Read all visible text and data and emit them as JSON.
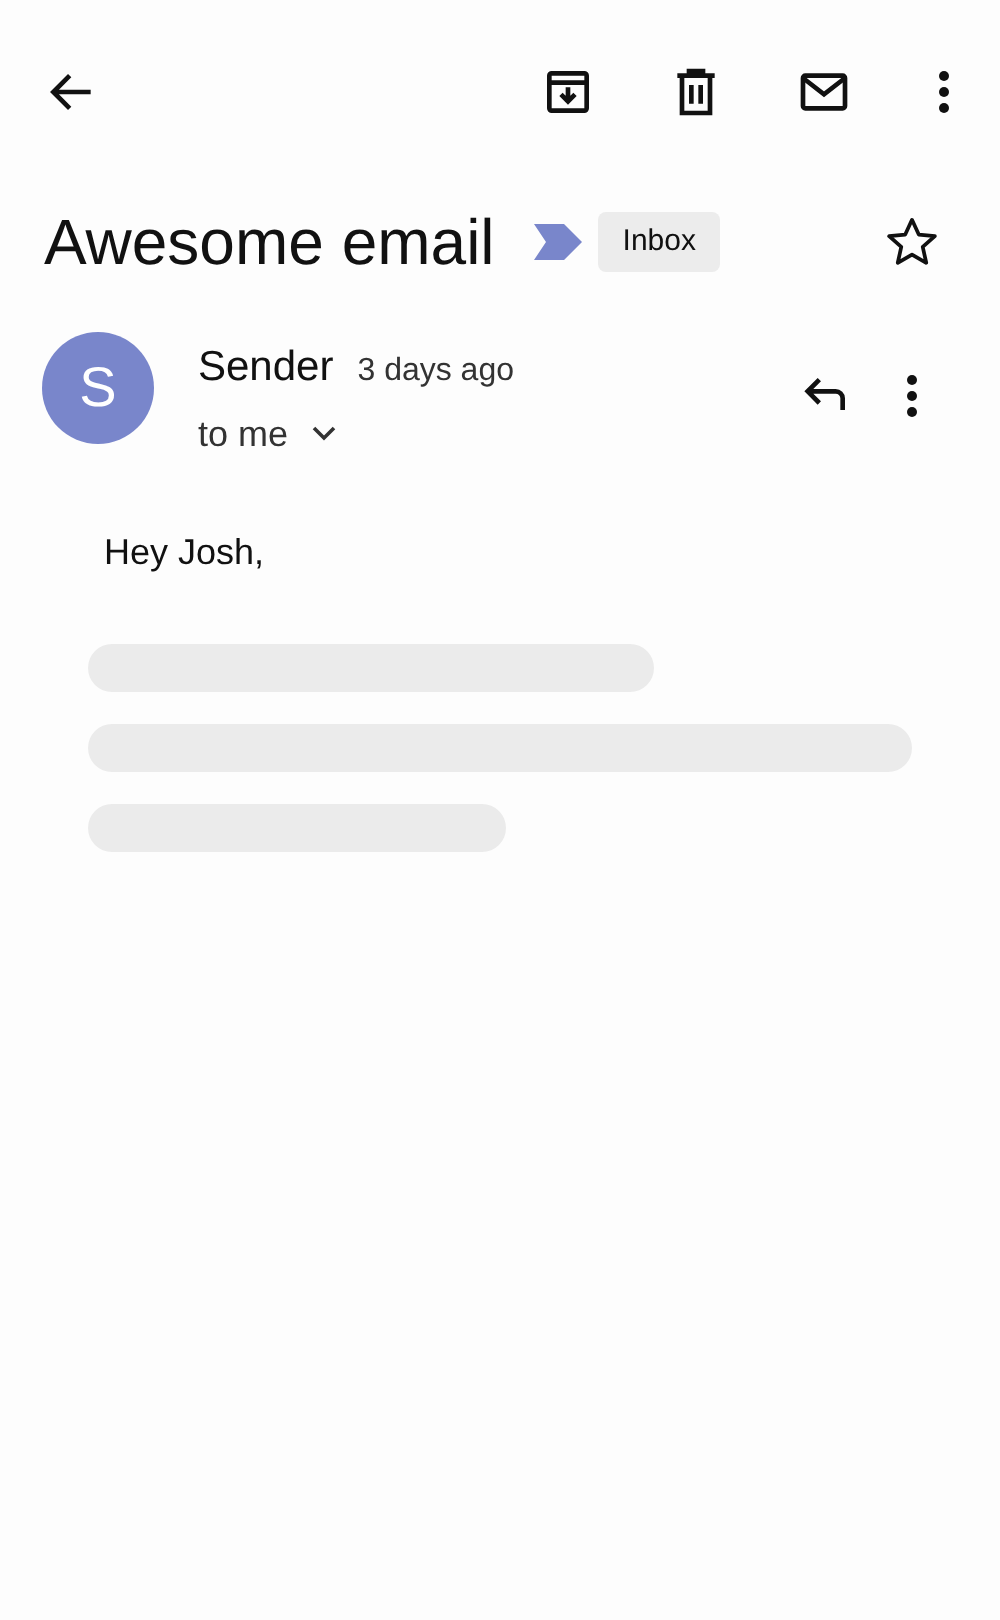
{
  "subject": "Awesome email",
  "label": {
    "text": "Inbox",
    "color": "#7986cb"
  },
  "starred": false,
  "message": {
    "avatar_letter": "S",
    "sender": "Sender",
    "time": "3 days ago",
    "recipient": "to me",
    "greeting": "Hey Josh,"
  }
}
